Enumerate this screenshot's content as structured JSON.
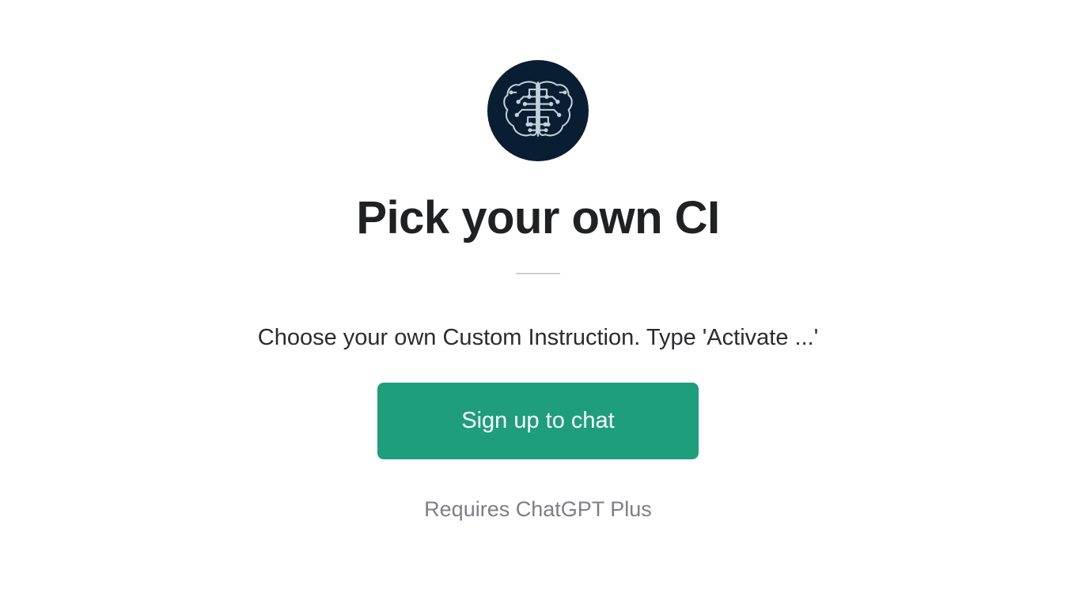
{
  "avatar": {
    "alt": "brain-circuit-icon"
  },
  "title": "Pick your own CI",
  "description": "Choose your own Custom Instruction. Type 'Activate ...'",
  "cta": {
    "label": "Sign up to chat"
  },
  "requirement": "Requires ChatGPT Plus",
  "colors": {
    "accent": "#1e9e7a",
    "avatar_bg": "#0a1e33",
    "text_primary": "#202123",
    "text_muted": "#7e7f84"
  }
}
